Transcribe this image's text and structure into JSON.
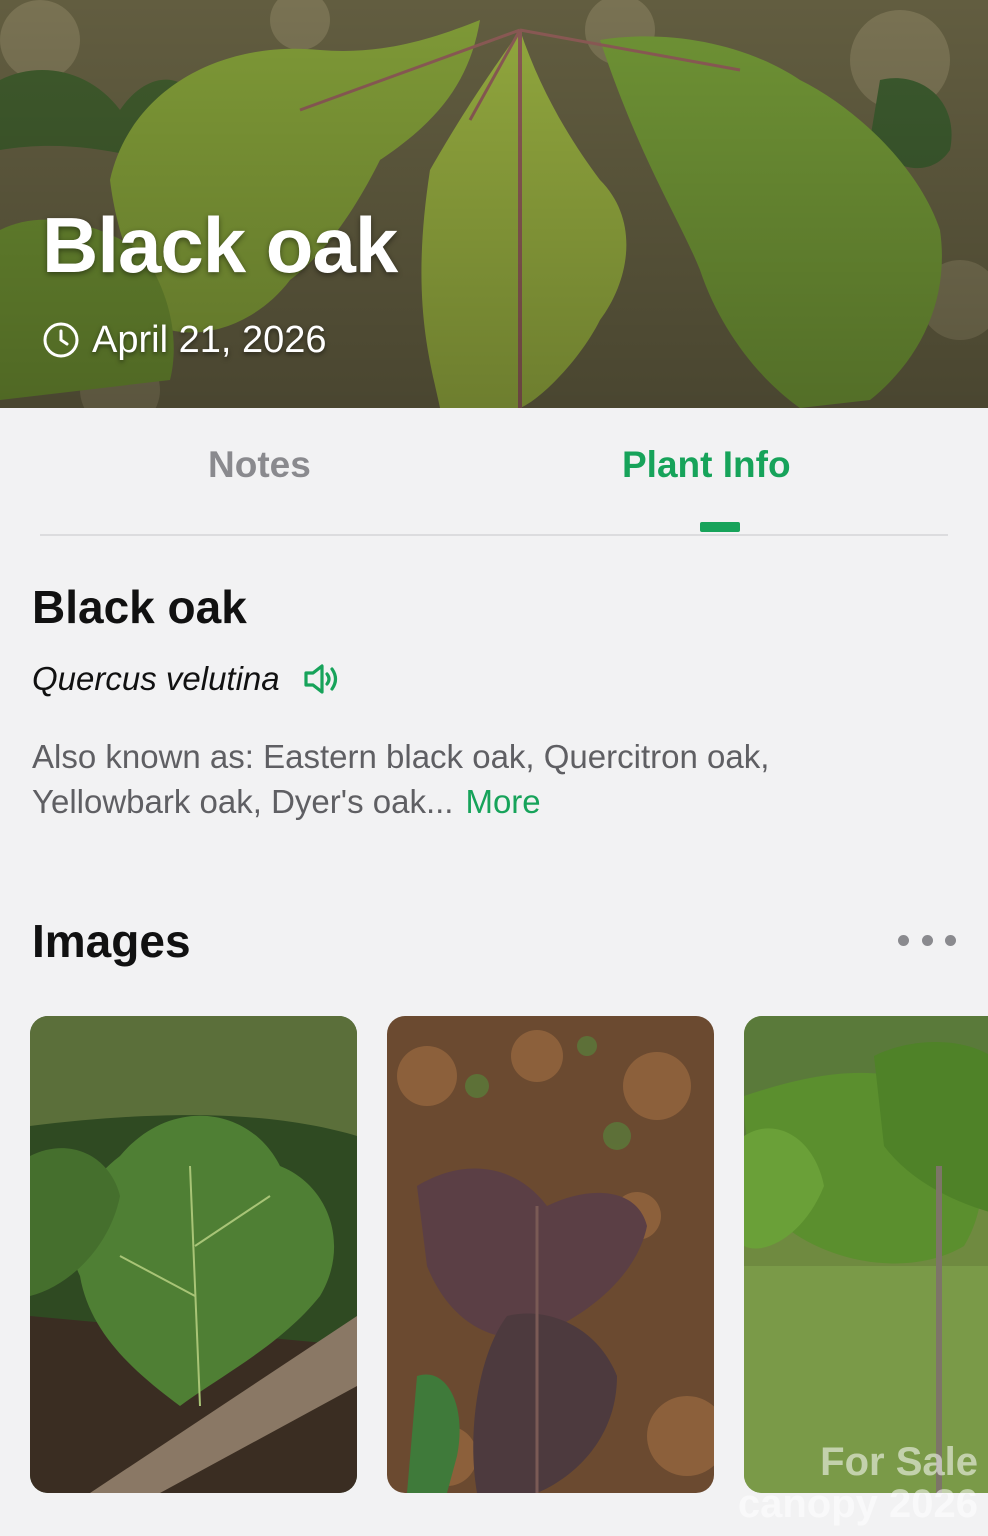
{
  "hero": {
    "title": "Black oak",
    "date": "April 21, 2026"
  },
  "tabs": [
    {
      "label": "Notes",
      "active": false
    },
    {
      "label": "Plant Info",
      "active": true
    }
  ],
  "plant": {
    "common_name": "Black oak",
    "scientific_name": "Quercus velutina",
    "also_known_as": "Also known as: Eastern black oak, Quercitron oak, Yellowbark oak, Dyer's oak...",
    "more_label": "More"
  },
  "images_section": {
    "title": "Images"
  },
  "watermark": {
    "line1": "For Sale",
    "line2": "canopy 2026"
  },
  "colors": {
    "accent": "#17a35a",
    "background": "#f2f2f3",
    "text": "#111111",
    "muted": "#8a8a8e"
  }
}
